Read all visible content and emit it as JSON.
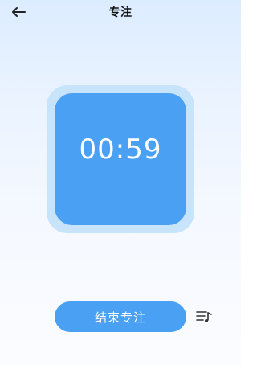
{
  "header": {
    "title": "专注",
    "back_icon": "arrow-left-icon"
  },
  "timer": {
    "time": "00:59"
  },
  "actions": {
    "end_label": "结束专注",
    "music_icon": "playlist-music-icon"
  },
  "colors": {
    "accent": "#4aa0f2",
    "accent_light": "#c8e4fb",
    "background_top": "#dcecff",
    "background_bottom": "#fbfcff"
  }
}
